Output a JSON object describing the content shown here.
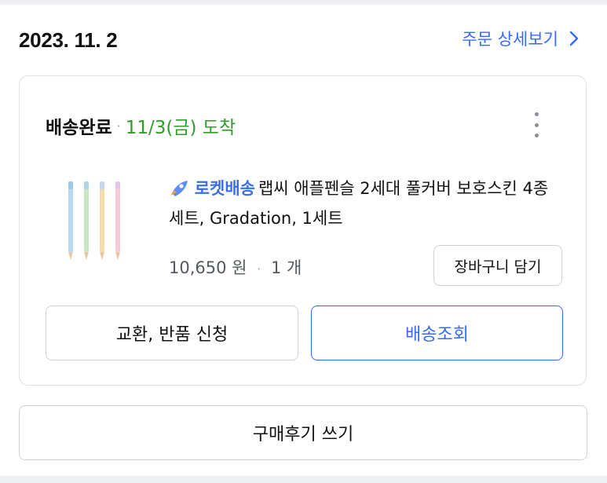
{
  "order": {
    "date": "2023. 11. 2",
    "detail_link": "주문 상세보기"
  },
  "shipment": {
    "status": "배송완료",
    "separator": "·",
    "arrival": "11/3(금) 도착"
  },
  "product": {
    "delivery_badge": "로켓배송",
    "name": "랩씨 애플펜슬 2세대 풀커버 보호스킨 4종 세트, Gradation, 1세트",
    "price": "10,650 원",
    "separator": "·",
    "quantity": "1 개",
    "add_to_cart_label": "장바구니 담기"
  },
  "actions": {
    "exchange_return_label": "교환, 반품 신청",
    "tracking_label": "배송조회",
    "write_review_label": "구매후기 쓰기"
  },
  "colors": {
    "accent": "#346aff",
    "arrival_green": "#2f9d27",
    "rocket_blue": "#3a6fe8"
  },
  "icons": {
    "detail_chevron": "chevron-right-icon",
    "more": "more-vertical-icon",
    "rocket": "rocket-icon"
  }
}
